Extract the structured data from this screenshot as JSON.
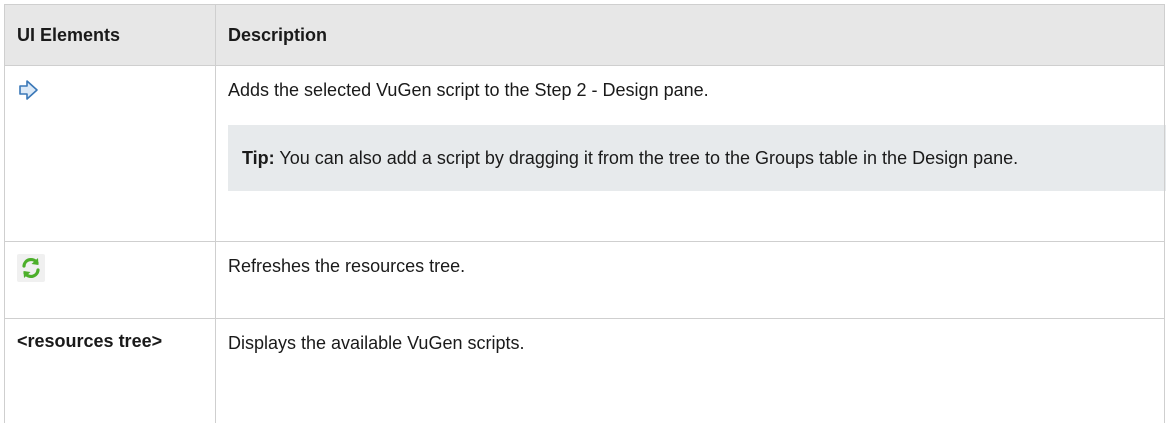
{
  "table": {
    "headers": {
      "ui_elements": "UI Elements",
      "description": "Description"
    },
    "rows": [
      {
        "element_icon": "add-script-arrow-icon",
        "description": "Adds the selected VuGen script to the Step 2 - Design pane.",
        "tip": {
          "label": "Tip:",
          "text": "You can also add a script by dragging it from the tree to the Groups table in the Design pane."
        }
      },
      {
        "element_icon": "refresh-icon",
        "description": "Refreshes the resources tree."
      },
      {
        "element_label": "<resources tree>",
        "description": "Displays the available VuGen scripts."
      }
    ]
  },
  "colors": {
    "header_bg": "#e7e7e7",
    "tip_bg": "#e7eaec",
    "border": "#cfcfcf",
    "refresh_green": "#4caf2a",
    "arrow_blue": "#3a78b8"
  }
}
